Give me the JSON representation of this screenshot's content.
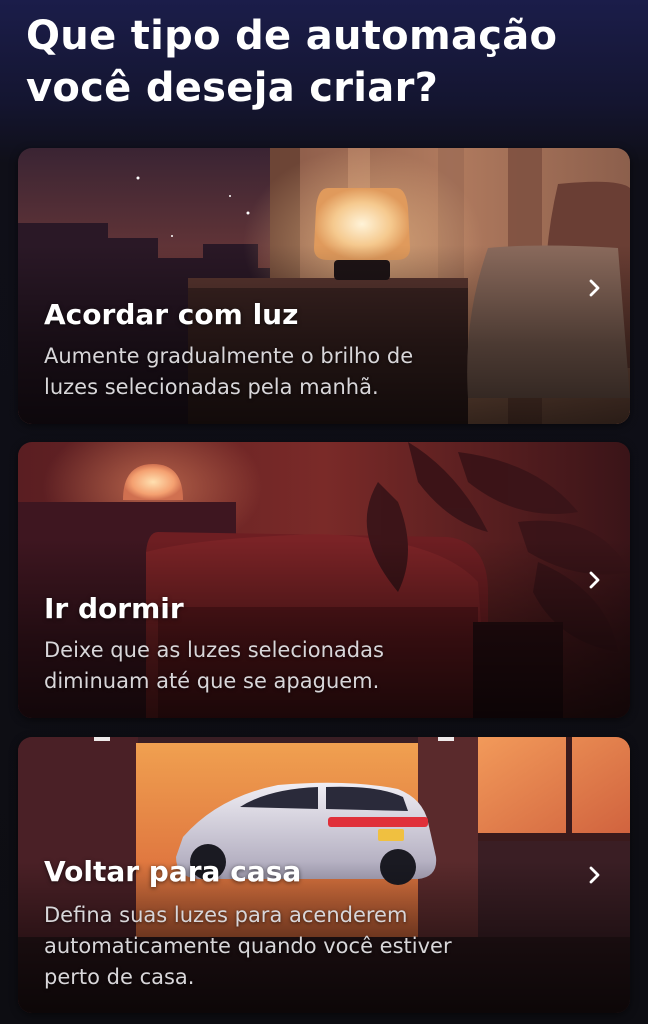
{
  "page": {
    "title_line1": "Que tipo de automação",
    "title_line2": "você deseja criar?"
  },
  "cards": [
    {
      "title": "Acordar com luz",
      "description_line1": "Aumente gradualmente o brilho de",
      "description_line2": "luzes selecionadas pela manhã."
    },
    {
      "title": "Ir dormir",
      "description_line1": "Deixe que as luzes selecionadas",
      "description_line2": "diminuam até que se apaguem."
    },
    {
      "title": "Voltar para casa",
      "description_line1": "Defina suas luzes para acenderem",
      "description_line2": "automaticamente quando você estiver",
      "description_line3": "perto de casa."
    }
  ],
  "icons": {
    "card_arrow": "chevron-right-icon"
  }
}
